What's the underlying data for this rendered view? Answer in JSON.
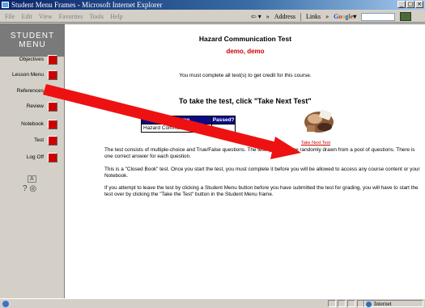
{
  "window": {
    "title": "Student Menu Frames - Microsoft Internet Explorer",
    "controls": [
      "_",
      "□",
      "×"
    ]
  },
  "menubar": {
    "menus": [
      "File",
      "Edit",
      "View",
      "Favorites",
      "Tools",
      "Help"
    ],
    "address_label": "Address",
    "links_label": "Links",
    "chevron": "»",
    "google_logo": [
      "G",
      "o",
      "o",
      "g",
      "l",
      "e"
    ],
    "google_suffix": "▾"
  },
  "student_menu": {
    "header_line1": "STUDENT",
    "header_line2": "MENU",
    "items": [
      {
        "label": "Objectives"
      },
      {
        "label": "Lesson Menu"
      },
      {
        "label": "References"
      },
      {
        "label": "Review"
      },
      {
        "label": "Notebook"
      },
      {
        "label": "Test"
      },
      {
        "label": "Log Off"
      }
    ],
    "text_size_icon": "A",
    "help_symbol": "?",
    "view_symbol": "◎"
  },
  "main": {
    "title": "Hazard Communication Test",
    "user": "demo, demo",
    "instruction": "You must complete all test(s) to get credit for this course.",
    "take_heading": "To take the test, click \"Take Next Test\"",
    "table": {
      "headers": [
        "Test Name",
        "Passed?"
      ],
      "rows": [
        [
          "Hazard Communication Test",
          ""
        ]
      ]
    },
    "take_next_link": "Take Next Test",
    "paragraphs": [
      "The test consists of multiple-choice and True/False questions. The test questions are randomly drawn from a pool of questions. There is one correct answer for each question.",
      "This is a \"Closed Book\" test. Once you start the test, you must complete it before you will be allowed to access any course content or your Notebook.",
      "If you attempt to leave the test by clicking a Student Menu button before you have submitted the test for grading, you will have to start the test over by clicking the \"Take the Test\" button in the Student Menu frame."
    ]
  },
  "statusbar": {
    "zone": "Internet"
  },
  "colors": {
    "accent_red": "#cc0000",
    "table_header": "#0a0a8a",
    "menu_header": "#7a7a7a",
    "arrow": "#ee1111"
  }
}
